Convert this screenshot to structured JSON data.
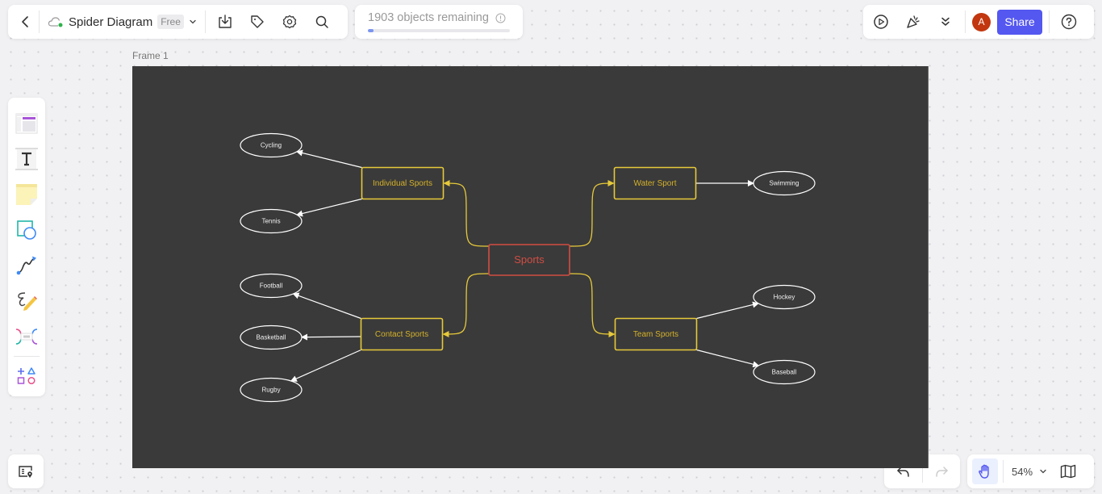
{
  "toolbar": {
    "back_icon": "chevron-left-icon",
    "cloud_status": "synced",
    "title": "Spider Diagram",
    "plan_badge": "Free",
    "icons": [
      "download-icon",
      "tag-icon",
      "gear-icon",
      "search-icon"
    ]
  },
  "objects": {
    "text": "1903 objects remaining",
    "remaining": 1903,
    "used_fraction": 0.04
  },
  "top_right": {
    "icons": [
      "play-icon",
      "party-popper-icon",
      "chevron-double-down-icon"
    ],
    "avatar_initial": "A",
    "avatar_color": "#c2370f",
    "share_label": "Share",
    "help_icon": "help-icon",
    "accent_color": "#5457f0"
  },
  "left_tools": [
    "template-tool",
    "text-tool",
    "sticky-note-tool",
    "shape-tool",
    "connector-tool",
    "pen-tool",
    "mind-map-tool",
    "more-shapes-tool"
  ],
  "zoom": {
    "level": "54%"
  },
  "frame": {
    "label": "Frame 1",
    "background": "#3a3a3a"
  },
  "diagram": {
    "root": {
      "label": "Sports",
      "color": "#d14d43"
    },
    "branch_color": "#e6c93a",
    "branches": [
      {
        "label": "Individual Sports",
        "children": [
          "Cycling",
          "Tennis"
        ]
      },
      {
        "label": "Water Sport",
        "children": [
          "Swimming"
        ]
      },
      {
        "label": "Contact Sports",
        "children": [
          "Football",
          "Basketball",
          "Rugby"
        ]
      },
      {
        "label": "Team Sports",
        "children": [
          "Hockey",
          "Baseball"
        ]
      }
    ]
  }
}
